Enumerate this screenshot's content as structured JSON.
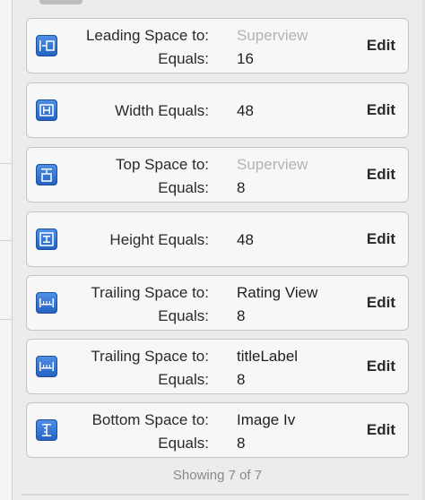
{
  "constraints": [
    {
      "icon": "leading-space-icon",
      "label1": "Leading Space to:",
      "value1": "Superview",
      "value1_muted": true,
      "label2": "Equals:",
      "value2": "16",
      "edit": "Edit"
    },
    {
      "icon": "width-icon",
      "label1": "Width Equals:",
      "value1": "48",
      "value1_muted": false,
      "label2": "",
      "value2": "",
      "edit": "Edit"
    },
    {
      "icon": "top-space-icon",
      "label1": "Top Space to:",
      "value1": "Superview",
      "value1_muted": true,
      "label2": "Equals:",
      "value2": "8",
      "edit": "Edit"
    },
    {
      "icon": "height-icon",
      "label1": "Height Equals:",
      "value1": "48",
      "value1_muted": false,
      "label2": "",
      "value2": "",
      "edit": "Edit"
    },
    {
      "icon": "trailing-space-icon",
      "label1": "Trailing Space to:",
      "value1": "Rating View",
      "value1_muted": false,
      "label2": "Equals:",
      "value2": "8",
      "edit": "Edit"
    },
    {
      "icon": "trailing-space-icon",
      "label1": "Trailing Space to:",
      "value1": "titleLabel",
      "value1_muted": false,
      "label2": "Equals:",
      "value2": "8",
      "edit": "Edit"
    },
    {
      "icon": "bottom-space-icon",
      "label1": "Bottom Space to:",
      "value1": "Image Iv",
      "value1_muted": false,
      "label2": "Equals:",
      "value2": "8",
      "edit": "Edit"
    }
  ],
  "footer": {
    "showing": "Showing 7 of 7"
  },
  "colors": {
    "icon_blue": "#2f6fd2",
    "muted": "#b3b3b3",
    "card_bg": "#f7f7f7"
  }
}
